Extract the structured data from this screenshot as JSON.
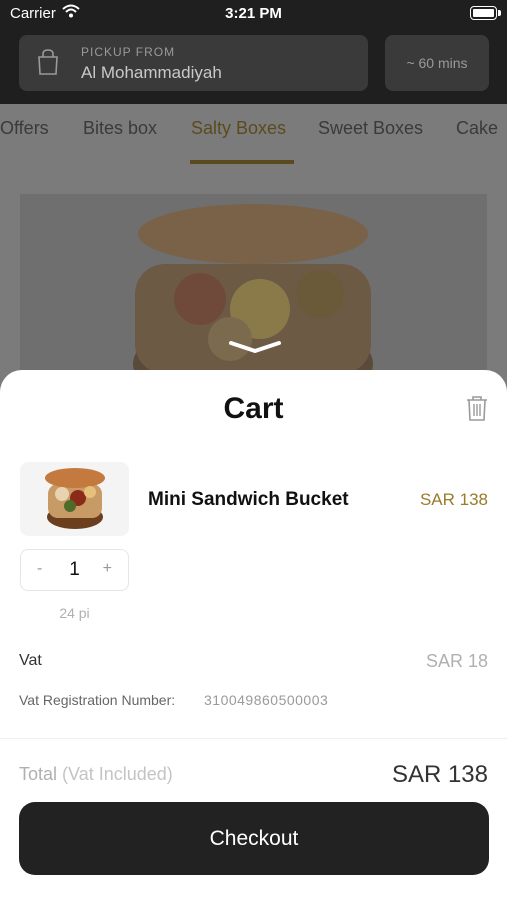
{
  "status_bar": {
    "carrier": "Carrier",
    "time": "3:21 PM"
  },
  "header": {
    "pickup_label": "PICKUP FROM",
    "pickup_location": "Al Mohammadiyah",
    "eta": "~ 60 mins"
  },
  "tabs": [
    {
      "label": "Offers"
    },
    {
      "label": "Bites box"
    },
    {
      "label": "Salty Boxes"
    },
    {
      "label": "Sweet Boxes"
    },
    {
      "label": "Cake"
    }
  ],
  "active_tab": "Salty Boxes",
  "cart": {
    "title": "Cart",
    "item": {
      "name": "Mini Sandwich Bucket",
      "price": "SAR 138",
      "quantity": "1",
      "minus": "-",
      "plus": "+",
      "unit": "24 pi"
    },
    "vat_label": "Vat",
    "vat_value": "SAR 18",
    "vat_registration_label": "Vat Registration Number:",
    "vat_registration_number": "310049860500003",
    "total_label": "Total",
    "total_note": "(Vat Included)",
    "total_value": "SAR 138",
    "checkout_label": "Checkout"
  },
  "colors": {
    "accent": "#9a7b2a",
    "dark": "#222222",
    "header_bg": "#1f1f1f"
  },
  "icons": [
    "wifi-icon",
    "battery-icon",
    "shopping-bag-icon",
    "chevron-down-icon",
    "trash-icon"
  ]
}
